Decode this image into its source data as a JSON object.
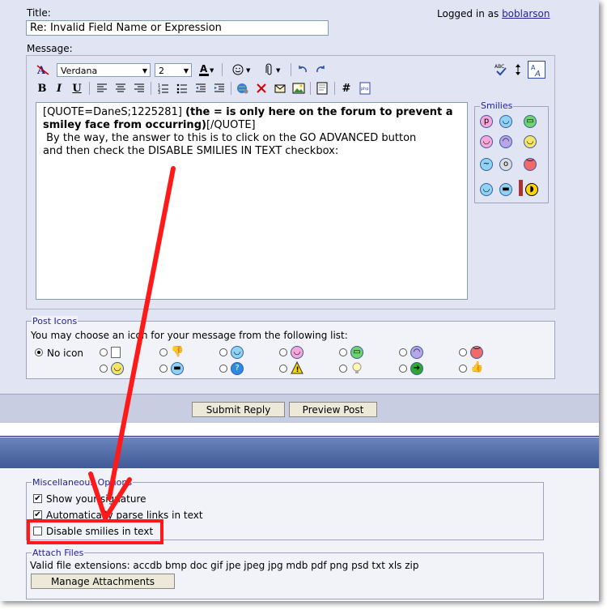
{
  "header": {
    "title_label": "Title:",
    "logged_in_text": "Logged in as",
    "username": "boblarson",
    "title_value": "Re: Invalid Field Name or Expression",
    "message_label": "Message:"
  },
  "toolbar": {
    "font_value": "Verdana",
    "size_value": "2",
    "bold": "B",
    "italic": "I",
    "underline": "U",
    "hash": "#"
  },
  "editor": {
    "quote_open": "[QUOTE=DaneS;1225281]",
    "bold_text": "(the = is only here on the forum to prevent a smiley face from occurring)",
    "quote_close": "[/QUOTE]",
    "line2": " By the way, the answer to this is to click on the GO ADVANCED button",
    "line3": "and then check the DISABLE SMILIES IN TEXT checkbox:"
  },
  "smilies": {
    "legend": "Smilies"
  },
  "post_icons": {
    "legend": "Post Icons",
    "instruction": "You may choose an icon for your message from the following list:",
    "no_icon_label": "No icon"
  },
  "buttons": {
    "submit": "Submit Reply",
    "preview": "Preview Post"
  },
  "misc": {
    "legend": "Miscellaneous Options",
    "show_signature": "Show your signature",
    "auto_parse": "Automatically parse links in text",
    "disable_smilies": "Disable smilies in text"
  },
  "attach": {
    "legend": "Attach Files",
    "extensions": "Valid file extensions: accdb bmp doc gif jpe jpeg jpg mdb pdf png psd txt xls zip",
    "manage_button": "Manage Attachments"
  },
  "colors": {
    "accent_red": "#ff1a1a",
    "link_blue": "#22229c",
    "header_band": "#3f5a97"
  }
}
